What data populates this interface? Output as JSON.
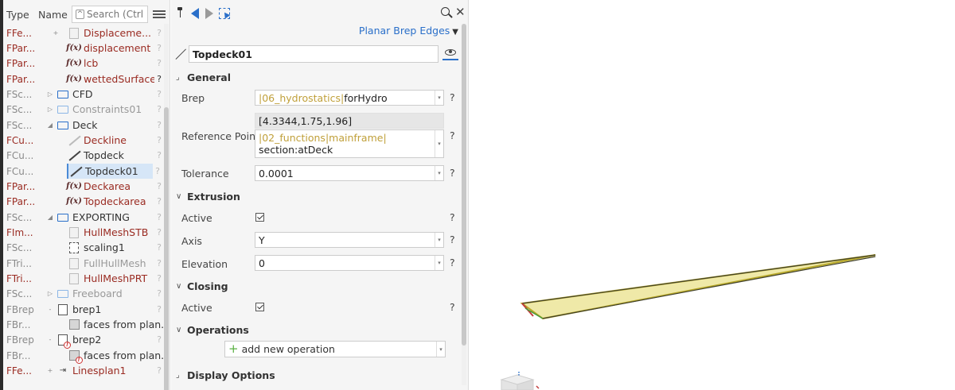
{
  "tree": {
    "header": {
      "type_label": "Type",
      "name_label": "Name",
      "search_placeholder": "Search (Ctrl..."
    },
    "rows": [
      {
        "type": "FFe...",
        "name": "Displaceme...",
        "q": "?"
      },
      {
        "type": "FPar...",
        "name": "displacement",
        "q": "?"
      },
      {
        "type": "FPar...",
        "name": "lcb",
        "q": "?"
      },
      {
        "type": "FPar...",
        "name": "wettedSurface",
        "q": "?"
      },
      {
        "type": "FSc...",
        "name": "CFD",
        "q": "?"
      },
      {
        "type": "FSc...",
        "name": "Constraints01",
        "q": "?"
      },
      {
        "type": "FSc...",
        "name": "Deck",
        "q": "?"
      },
      {
        "type": "FCu...",
        "name": "Deckline",
        "q": "?"
      },
      {
        "type": "FCu...",
        "name": "Topdeck",
        "q": "?"
      },
      {
        "type": "FCu...",
        "name": "Topdeck01",
        "q": "?"
      },
      {
        "type": "FPar...",
        "name": "Deckarea",
        "q": "?"
      },
      {
        "type": "FPar...",
        "name": "Topdeckarea",
        "q": "?"
      },
      {
        "type": "FSc...",
        "name": "EXPORTING",
        "q": "?"
      },
      {
        "type": "FIm...",
        "name": "HullMeshSTB",
        "q": "?"
      },
      {
        "type": "FSc...",
        "name": "scaling1",
        "q": "?"
      },
      {
        "type": "FTri...",
        "name": "FullHullMesh",
        "q": "?"
      },
      {
        "type": "FTri...",
        "name": "HullMeshPRT",
        "q": "?"
      },
      {
        "type": "FSc...",
        "name": "Freeboard",
        "q": "?"
      },
      {
        "type": "FBrep",
        "name": "brep1",
        "q": "?"
      },
      {
        "type": "FBr...",
        "name": "faces from plan...",
        "q": ""
      },
      {
        "type": "FBrep",
        "name": "brep2",
        "q": "?"
      },
      {
        "type": "FBr...",
        "name": "faces from plan...",
        "q": ""
      },
      {
        "type": "FFe...",
        "name": "Linesplan1",
        "q": "?"
      }
    ]
  },
  "props": {
    "edge_type": "Planar Brep Edges",
    "object_name": "Topdeck01",
    "sections": {
      "general": "General",
      "extrusion": "Extrusion",
      "closing": "Closing",
      "operations": "Operations",
      "display": "Display Options"
    },
    "brep": {
      "label": "Brep",
      "ref": "|06_hydrostatics|",
      "value": "forHydro"
    },
    "reference_point": {
      "label": "Reference Point",
      "computed": "[4.3344,1.75,1.96]",
      "ref": "|02_functions|mainframe|",
      "value": "section:atDeck"
    },
    "tolerance": {
      "label": "Tolerance",
      "value": "0.0001"
    },
    "extrusion_active": {
      "label": "Active",
      "checked": true
    },
    "axis": {
      "label": "Axis",
      "value": "Y"
    },
    "elevation": {
      "label": "Elevation",
      "value": "0"
    },
    "closing_active": {
      "label": "Active",
      "checked": true
    },
    "add_operation": "add new operation",
    "help": "?"
  },
  "colors": {
    "accent": "#2a6fc9",
    "reference": "#c0a03a",
    "feature_red": "#9a2b22",
    "surface_yellow": "#d4cc46"
  }
}
